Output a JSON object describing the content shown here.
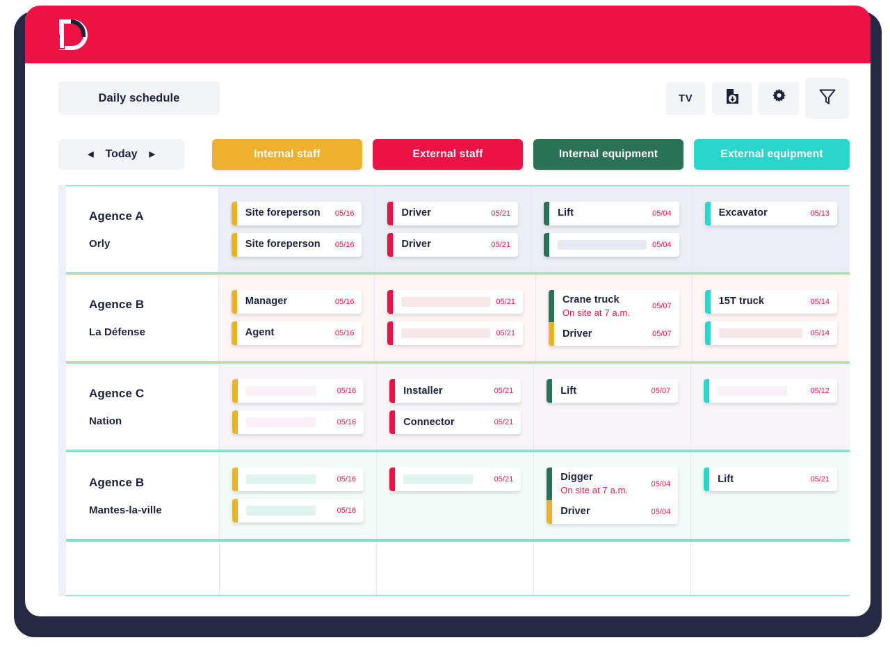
{
  "brand": {
    "logo_icon": "letter-d-logo",
    "header_color": "#ec1246",
    "accent_navy": "#1b2138"
  },
  "header": {
    "title": "Daily schedule",
    "tools": [
      {
        "name": "tv-button",
        "label": "TV",
        "icon": "tv-text"
      },
      {
        "name": "export-button",
        "label": "",
        "icon": "document-download-icon"
      },
      {
        "name": "settings-button",
        "label": "",
        "icon": "gear-icon"
      },
      {
        "name": "filter-button",
        "label": "",
        "icon": "funnel-icon"
      }
    ]
  },
  "date_nav": {
    "prev_icon": "chevron-left-icon",
    "label": "Today",
    "next_icon": "chevron-right-icon"
  },
  "tabs": [
    {
      "label": "Internal staff",
      "color": "#eeb12d"
    },
    {
      "label": "External staff",
      "color": "#ec1246"
    },
    {
      "label": "Internal equipment",
      "color": "#2a7158"
    },
    {
      "label": "External equipment",
      "color": "#2ad6cb"
    }
  ],
  "colors": {
    "internal_staff": "#eeb12d",
    "external_staff": "#ec1246",
    "internal_equipment": "#2a7158",
    "external_equipment": "#2ad6cb",
    "date_text": "#ec1246",
    "placeholder_lavender": "#e8e9f2",
    "placeholder_pink": "#fbeef3",
    "placeholder_rose": "#f7e7ea",
    "placeholder_mint": "#dff4ef"
  },
  "rows": [
    {
      "agency": "Agence A",
      "location": "Orly",
      "border_color": "#9fe3d2",
      "tint": "#eceef5",
      "columns": [
        {
          "groups": [
            {
              "cards": [
                {
                  "label": "Site foreperson",
                  "sub": "",
                  "date": "05/16",
                  "bar": "#eeb12d",
                  "placeholder": false
                }
              ]
            },
            {
              "cards": [
                {
                  "label": "Site foreperson",
                  "sub": "",
                  "date": "05/16",
                  "bar": "#eeb12d",
                  "placeholder": false
                }
              ]
            }
          ]
        },
        {
          "groups": [
            {
              "cards": [
                {
                  "label": "Driver",
                  "sub": "",
                  "date": "05/21",
                  "bar": "#ec1246",
                  "placeholder": false
                }
              ]
            },
            {
              "cards": [
                {
                  "label": "Driver",
                  "sub": "",
                  "date": "05/21",
                  "bar": "#ec1246",
                  "placeholder": false
                }
              ]
            }
          ]
        },
        {
          "groups": [
            {
              "cards": [
                {
                  "label": "Lift",
                  "sub": "",
                  "date": "05/04",
                  "bar": "#2a7158",
                  "placeholder": false
                }
              ]
            },
            {
              "cards": [
                {
                  "label": "",
                  "sub": "",
                  "date": "05/04",
                  "bar": "#2a7158",
                  "placeholder": true,
                  "ph_color": "#e8e9f2",
                  "ph_width": 128
                }
              ]
            }
          ]
        },
        {
          "groups": [
            {
              "cards": [
                {
                  "label": "Excavator",
                  "sub": "",
                  "date": "05/13",
                  "bar": "#2ad6cb",
                  "placeholder": false
                }
              ]
            }
          ]
        }
      ]
    },
    {
      "agency": "Agence B",
      "location": "La Défense",
      "border_color": "#ddd2a0",
      "tint": "#fdf5f6",
      "columns": [
        {
          "groups": [
            {
              "cards": [
                {
                  "label": "Manager",
                  "sub": "",
                  "date": "05/16",
                  "bar": "#eeb12d",
                  "placeholder": false
                }
              ]
            },
            {
              "cards": [
                {
                  "label": "Agent",
                  "sub": "",
                  "date": "05/16",
                  "bar": "#eeb12d",
                  "placeholder": false
                }
              ]
            }
          ]
        },
        {
          "groups": [
            {
              "cards": [
                {
                  "label": "",
                  "sub": "",
                  "date": "05/21",
                  "bar": "#ec1246",
                  "placeholder": true,
                  "ph_color": "#f7e7ea",
                  "ph_width": 128
                }
              ]
            },
            {
              "cards": [
                {
                  "label": "",
                  "sub": "",
                  "date": "05/21",
                  "bar": "#ec1246",
                  "placeholder": true,
                  "ph_color": "#f7e7ea",
                  "ph_width": 128
                }
              ]
            }
          ]
        },
        {
          "groups": [
            {
              "cards": [
                {
                  "label": "Crane truck",
                  "sub": "On site at 7 a.m.",
                  "date": "05/07",
                  "bar": "#2a7158",
                  "placeholder": false
                },
                {
                  "label": "Driver",
                  "sub": "",
                  "date": "05/07",
                  "bar": "#eeb12d",
                  "placeholder": false
                }
              ],
              "combined": true
            }
          ]
        },
        {
          "groups": [
            {
              "cards": [
                {
                  "label": "15T truck",
                  "sub": "",
                  "date": "05/14",
                  "bar": "#2ad6cb",
                  "placeholder": false
                }
              ]
            },
            {
              "cards": [
                {
                  "label": "",
                  "sub": "",
                  "date": "05/14",
                  "bar": "#2ad6cb",
                  "placeholder": true,
                  "ph_color": "#f7e7ea",
                  "ph_width": 120
                }
              ]
            }
          ]
        }
      ]
    },
    {
      "agency": "Agence C",
      "location": "Nation",
      "border_color": "#9fe3d2",
      "tint": "#f7f5f8",
      "columns": [
        {
          "groups": [
            {
              "cards": [
                {
                  "label": "",
                  "sub": "",
                  "date": "05/16",
                  "bar": "#eeb12d",
                  "placeholder": true,
                  "ph_color": "#faf0f8",
                  "ph_width": 100
                }
              ]
            },
            {
              "cards": [
                {
                  "label": "",
                  "sub": "",
                  "date": "05/16",
                  "bar": "#eeb12d",
                  "placeholder": true,
                  "ph_color": "#faf0f8",
                  "ph_width": 100
                }
              ]
            }
          ]
        },
        {
          "groups": [
            {
              "cards": [
                {
                  "label": "Installer",
                  "sub": "",
                  "date": "05/21",
                  "bar": "#ec1246",
                  "placeholder": false
                }
              ]
            },
            {
              "cards": [
                {
                  "label": "Connector",
                  "sub": "",
                  "date": "05/21",
                  "bar": "#ec1246",
                  "placeholder": false
                }
              ]
            }
          ]
        },
        {
          "groups": [
            {
              "cards": [
                {
                  "label": "Lift",
                  "sub": "",
                  "date": "05/07",
                  "bar": "#2a7158",
                  "placeholder": false
                }
              ]
            }
          ]
        },
        {
          "groups": [
            {
              "cards": [
                {
                  "label": "",
                  "sub": "",
                  "date": "05/12",
                  "bar": "#2ad6cb",
                  "placeholder": true,
                  "ph_color": "#faf0f8",
                  "ph_width": 100
                }
              ]
            }
          ]
        }
      ]
    },
    {
      "agency": "Agence B",
      "location": "Mantes-la-ville",
      "border_color": "#6fdfc9",
      "tint": "#f2fbf8",
      "columns": [
        {
          "groups": [
            {
              "cards": [
                {
                  "label": "",
                  "sub": "",
                  "date": "05/16",
                  "bar": "#eeb12d",
                  "placeholder": true,
                  "ph_color": "#dff4ef",
                  "ph_width": 100
                }
              ]
            },
            {
              "cards": [
                {
                  "label": "",
                  "sub": "",
                  "date": "05/16",
                  "bar": "#eeb12d",
                  "placeholder": true,
                  "ph_color": "#dff4ef",
                  "ph_width": 100
                }
              ]
            }
          ]
        },
        {
          "groups": [
            {
              "cards": [
                {
                  "label": "",
                  "sub": "",
                  "date": "05/21",
                  "bar": "#ec1246",
                  "placeholder": true,
                  "ph_color": "#dff4ef",
                  "ph_width": 100
                }
              ]
            }
          ]
        },
        {
          "groups": [
            {
              "cards": [
                {
                  "label": "Digger",
                  "sub": "On site at 7 a.m.",
                  "date": "05/04",
                  "bar": "#2a7158",
                  "placeholder": false
                },
                {
                  "label": "Driver",
                  "sub": "",
                  "date": "05/04",
                  "bar": "#eeb12d",
                  "placeholder": false
                }
              ],
              "combined": true
            }
          ]
        },
        {
          "groups": [
            {
              "cards": [
                {
                  "label": "Lift",
                  "sub": "",
                  "date": "05/21",
                  "bar": "#2ad6cb",
                  "placeholder": false
                }
              ]
            }
          ]
        }
      ]
    },
    {
      "agency": "",
      "location": "",
      "border_color": "#9fe3d2",
      "tint": "#ffffff",
      "empty": true,
      "columns": [
        {
          "groups": []
        },
        {
          "groups": []
        },
        {
          "groups": []
        },
        {
          "groups": []
        }
      ]
    }
  ]
}
